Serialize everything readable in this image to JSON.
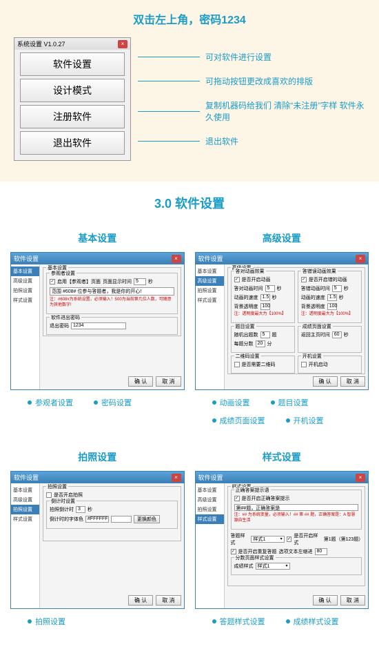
{
  "header": "双击左上角，密码1234",
  "menuWindow": {
    "title": "系统设置 V1.0.27",
    "items": [
      "软件设置",
      "设计模式",
      "注册软件",
      "退出软件"
    ]
  },
  "annotations": [
    "可对软件进行设置",
    "可拖动按钮更改成喜欢的排版",
    "复制机器码给我们 清除“未注册”字样 软件永久使用",
    "退出软件"
  ],
  "sectionTitle": "3.0 软件设置",
  "panels": {
    "basic": {
      "label": "基本设置",
      "dialogTitle": "软件设置",
      "sidebar": [
        "基本设置",
        "高级设置",
        "拍照设置",
        "样式设置"
      ],
      "active": 0,
      "groupTitle": "基本设置",
      "subGroup": "参观者设置",
      "chk1": "启用【参观者】页面",
      "chk1suffix": "页面显示时间",
      "chk1val": "5",
      "chk1unit": "秒",
      "placeholder": "范围 #608# 位参与答题者，我是你的开心!",
      "note": "注：#608#为系统设置，必须输入！500为当前第几位人数，可随意为其他数字!",
      "pwdGroup": "软件进出密码",
      "pwdLabel": "退出密码",
      "pwdVal": "1234",
      "okBtn": "确 认",
      "cancelBtn": "取 消",
      "bullets": [
        "参观者设置",
        "密码设置"
      ]
    },
    "advanced": {
      "label": "高级设置",
      "dialogTitle": "软件设置",
      "sidebar": [
        "基本设置",
        "高级设置",
        "拍照设置",
        "样式设置"
      ],
      "active": 1,
      "groupTitle": "高级设置",
      "leftGroup": "答对动画效果",
      "rightGroup": "答错误动画效果",
      "chkL": "是否开启动画",
      "chkR": "是否开启错的动画",
      "lbl_interval": "答对动画时间",
      "lbl_intervalR": "答错动画时间",
      "val_interval": "5",
      "val_intervalR": "5",
      "unit_sec": "秒",
      "lbl_speed": "动画的速度",
      "lbl_speedR": "动画的速度",
      "val_speed": "1.5",
      "val_speedR": "1.5",
      "lbl_alpha": "背景透明度",
      "lbl_alphaR": "背景透明度",
      "val_alpha": "100",
      "noteL": "注：透明度最大为【100%】",
      "noteR": "注：透明度最大为【100%】",
      "qGroup": "题目设置",
      "qLbl1": "随机出题数",
      "qVal1": "5",
      "qUnit1": "题",
      "qLbl2": "每题分数",
      "qVal2": "20",
      "qUnit2": "分",
      "pageGroup": "成绩页面设置",
      "pageLbl": "返回主页时间",
      "pageVal": "60",
      "pageUnit": "秒",
      "qrGroup": "二维码设置",
      "qrChk": "是否需要二维码",
      "bootGroup": "开机设置",
      "bootChk": "开机启动",
      "bullets": [
        "动画设置",
        "题目设置",
        "成绩页面设置",
        "开机设置"
      ]
    },
    "photo": {
      "label": "拍照设置",
      "dialogTitle": "软件设置",
      "sidebar": [
        "基本设置",
        "高级设置",
        "拍照设置",
        "样式设置"
      ],
      "active": 2,
      "groupTitle": "拍照设置",
      "chk": "是否开启拍照",
      "countGroup": "倒计时设置",
      "countLbl": "拍照倒计时",
      "countVal": "3",
      "countUnit": "秒",
      "colorLbl": "倒计时的字体色",
      "colorVal": "#FFFFFF",
      "colorBtn": "更换颜色",
      "bullets": [
        "拍照设置"
      ]
    },
    "style": {
      "label": "样式设置",
      "dialogTitle": "软件设置",
      "sidebar": [
        "基本设置",
        "高级设置",
        "拍照设置",
        "样式设置"
      ],
      "active": 3,
      "groupTitle": "样式设置",
      "hintGroup": "正确答案提示语",
      "hintChk": "是否开启正确答案提示",
      "hintLbl": "第##题，正确答案是",
      "hintNote": "注：## 为系统变量，必须输入！## 第 ## 题，正确答案是：A 智慧源自生活",
      "ansLbl": "答题样式",
      "ansDrop": "样式1",
      "ansChk": "是否开启样式",
      "ansChk2": "第1题（第123题）",
      "repeatChk": "是否开启重复答题",
      "repeatLbl": "选项文本左缩进",
      "repeatVal": "80",
      "scoreGroup": "分数页面样式设置",
      "scoreLbl": "成绩样式",
      "scoreDrop": "样式1",
      "bullets": [
        "答题样式设置",
        "成绩样式设置"
      ]
    }
  }
}
